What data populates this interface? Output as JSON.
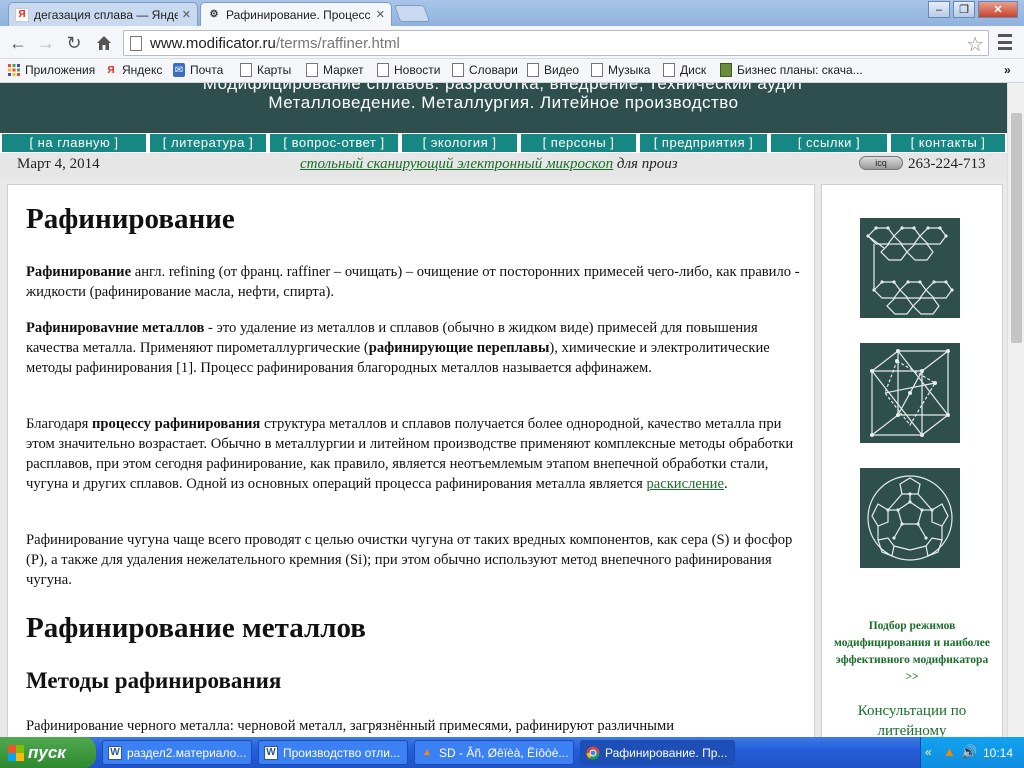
{
  "browser": {
    "tabs": [
      {
        "title": "дегазация сплава — Яндек",
        "favicon": "Я"
      },
      {
        "title": "Рафинирование. Процесс р",
        "favicon": "⚙"
      }
    ],
    "window_controls": {
      "minimize": "–",
      "maximize": "❐",
      "close": "✕"
    },
    "address": {
      "host": "www.modificator.ru",
      "path": "/terms/raffiner.html"
    },
    "bookmarks": [
      {
        "label": "Приложения",
        "icon": "apps-grid-icon"
      },
      {
        "label": "Яндекс",
        "icon": "yandex-icon"
      },
      {
        "label": "Почта",
        "icon": "mail-icon"
      },
      {
        "label": "Карты",
        "icon": "page-icon"
      },
      {
        "label": "Маркет",
        "icon": "page-icon"
      },
      {
        "label": "Новости",
        "icon": "page-icon"
      },
      {
        "label": "Словари",
        "icon": "page-icon"
      },
      {
        "label": "Видео",
        "icon": "page-icon"
      },
      {
        "label": "Музыка",
        "icon": "page-icon"
      },
      {
        "label": "Диск",
        "icon": "page-icon"
      },
      {
        "label": "Бизнес планы: скача...",
        "icon": "book-icon"
      }
    ],
    "more": "»"
  },
  "site": {
    "header_line1": "Модифицирование сплавов: разработка, внедрение, технический аудит",
    "header_line2": "Металловедение. Металлургия. Литейное производство",
    "menu": [
      "[ на главную ]",
      "[ литература ]",
      "[ вопрос-ответ ]",
      "[ экология ]",
      "[ персоны ]",
      "[ предприятия ]",
      "[ ссылки ]",
      "[ контакты ]"
    ],
    "date": "Март 4, 2014",
    "ticker_link": "стольный сканирующий электронный микроскоп",
    "ticker_rest": " для произ",
    "icq_label": "icq",
    "icq_number": "263-224-713"
  },
  "article": {
    "h1": "Рафинирование",
    "p1_bold": "Рафинирование",
    "p1": " англ. refining (от франц. raffiner – очищать) – очищение от посторонних примесей чего-либо, как правило - жидкости (рафинирование масла, нефти, спирта).",
    "p2_bold": "Рафинироваvние металлов",
    "p2_a": " - это удаление из металлов и сплавов (обычно в жидком виде) примесей для повышения качества металла. Применяют пирометаллургические (",
    "p2_bold2": "рафинирующие переплавы",
    "p2_b": "), химические и электролитические методы рафинирования [1]. Процесс рафинирования благородных металлов называется аффинажем.",
    "p3_a": "Благодаря ",
    "p3_bold": "процессу рафинирования",
    "p3_b": " структура металлов и сплавов получается более однородной, качество металла при этом значительно возрастает. Обычно в металлургии и литейном производстве применяют комплексные методы обработки расплавов, при этом сегодня рафинирование, как правило, является неотъемлемым этапом внепечной обработки стали, чугуна и других сплавов. Одной из основных операций процесса рафинирования металла является ",
    "p3_link": "раскисление",
    "p3_end": ".",
    "p4": "Рафинирование чугуна чаще всего проводят с целью очистки чугуна от таких вредных компонентов, как сера (S) и фосфор (P), а также для удаления нежелательного кремния (Si); при этом обычно используют метод внепечного рафинирования чугуна.",
    "h2": "Рафинирование металлов",
    "h3": "Методы рафинирования",
    "p5": "Рафинирование черного металла: черновой металл, загрязнённый примесями, рафинируют различными"
  },
  "sidebar": {
    "promo": "Подбор режимов модифицирования и наиболее эффективного модификатора >>",
    "consult": "Консультации по литейному"
  },
  "taskbar": {
    "start": "пуск",
    "tasks": [
      {
        "label": "раздел2.материало...",
        "icon": "word-doc-icon"
      },
      {
        "label": "Производство отли...",
        "icon": "word-doc-icon"
      },
      {
        "label": "SD - Âñ, Øêïèà, Ëíôòè...",
        "icon": "vlc-icon"
      },
      {
        "label": "Рафинирование. Пр...",
        "icon": "chrome-icon"
      }
    ],
    "clock": "10:14"
  }
}
